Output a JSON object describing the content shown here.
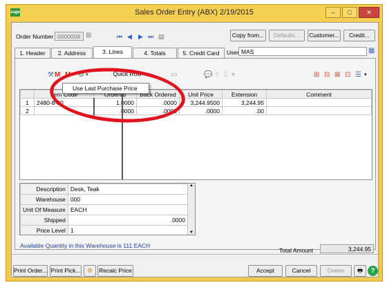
{
  "window": {
    "title": "Sales Order Entry (ABX) 2/19/2015",
    "app_icon_text": "sage",
    "buttons": {
      "minimize": "–",
      "maximize": "□",
      "close": "✕"
    }
  },
  "header": {
    "order_number_label": "Order Number",
    "order_number_value": "0000008",
    "copy_from_label": "Copy from...",
    "defaults_label": "Defaults...",
    "customer_label": "Customer...",
    "credit_label": "Credit...",
    "user_label": "User",
    "user_value": "MAS"
  },
  "tabs": [
    {
      "label": "1. Header"
    },
    {
      "label": "2. Address"
    },
    {
      "label": "3. Lines"
    },
    {
      "label": "4. Totals"
    },
    {
      "label": "5. Credit Card"
    }
  ],
  "toolbar": {
    "quick_row_label": "Quick Row",
    "popup_item_label": "Use Last Purchase Price"
  },
  "grid": {
    "columns": [
      "",
      "Item Code",
      "Ordered",
      "Back Ordered",
      "Unit Price",
      "Extension",
      "Comment"
    ],
    "rows": [
      {
        "num": "1",
        "item_code": "2480-8-50",
        "ordered": "1.0000",
        "back_ordered": ".0000",
        "unit_price": "3,244.9500",
        "extension": "3,244.95",
        "comment": ""
      },
      {
        "num": "2",
        "item_code": "",
        "ordered": ".0000",
        "back_ordered": ".0000",
        "unit_price": ".0000",
        "extension": ".00",
        "comment": ""
      }
    ]
  },
  "detail": [
    {
      "label": "Description",
      "value": "Desk, Teak"
    },
    {
      "label": "Warehouse",
      "value": "000"
    },
    {
      "label": "Unit Of Measure",
      "value": "EACH"
    },
    {
      "label": "Shipped",
      "value": ".0000"
    },
    {
      "label": "Price Level",
      "value": "1"
    }
  ],
  "footer": {
    "available_text": "Available Quantity in this Warehouse is 111 EACH",
    "total_amount_label": "Total Amount",
    "total_amount_value": "3,244.95"
  },
  "bottom_buttons": {
    "print_order": "Print Order...",
    "print_pick": "Print Pick...",
    "recalc_price": "Recalc Price",
    "accept": "Accept",
    "cancel": "Cancel",
    "delete": "Delete"
  },
  "colors": {
    "window_frame": "#f2c94c",
    "annotation_ellipse": "#e0141e",
    "available_text": "#1b3ea8"
  }
}
